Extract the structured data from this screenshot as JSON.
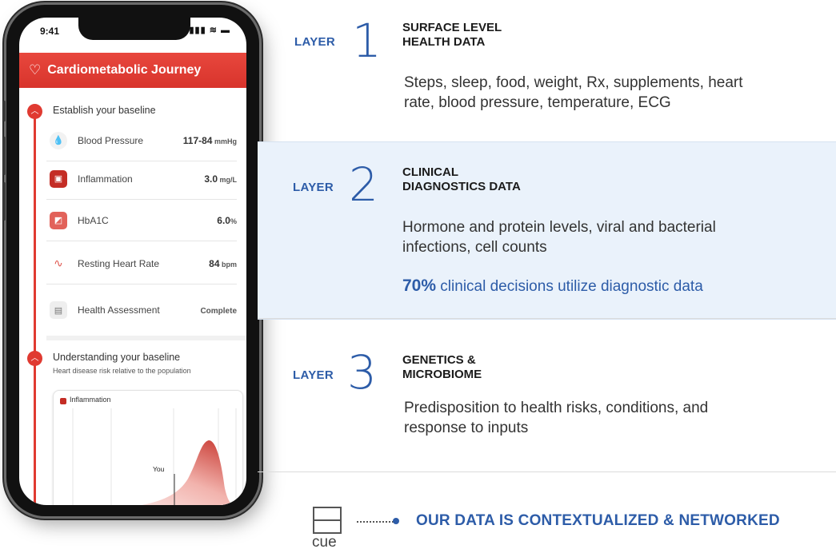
{
  "phone": {
    "status_time": "9:41",
    "status_icons": "▮▮▮ ≋ ▬",
    "app_title": "Cardiometabolic Journey",
    "section1": {
      "title": "Establish your baseline",
      "metrics": [
        {
          "label": "Blood Pressure",
          "value": "117-84",
          "unit": " mmHg",
          "icon": "blood-drop-icon"
        },
        {
          "label": "Inflammation",
          "value": "3.0",
          "unit": " mg/L",
          "icon": "inflammation-icon"
        },
        {
          "label": "HbA1C",
          "value": "6.0",
          "unit": "%",
          "icon": "hba1c-icon"
        },
        {
          "label": "Resting Heart Rate",
          "value": "84",
          "unit": " bpm",
          "icon": "heartbeat-icon"
        },
        {
          "label": "Health Assessment",
          "value": "",
          "unit": "Complete",
          "icon": "document-icon"
        }
      ]
    },
    "section2": {
      "title": "Understanding your baseline",
      "subtitle": "Heart disease risk relative to the population"
    },
    "chart": {
      "legend": "Inflammation",
      "marker_label": "You",
      "color": "#c42d25"
    }
  },
  "layers": [
    {
      "word": "LAYER",
      "number": "1",
      "heading_line1": "SURFACE LEVEL",
      "heading_line2": "HEALTH DATA",
      "desc_line1": "Steps, sleep, food, weight, Rx, supplements, heart",
      "desc_line2": "rate, blood pressure, temperature, ECG"
    },
    {
      "word": "LAYER",
      "number": "2",
      "heading_line1": "CLINICAL",
      "heading_line2": "DIAGNOSTICS DATA",
      "desc_line1": "Hormone and protein levels, viral and bacterial",
      "desc_line2": "infections, cell counts",
      "stat_pct": "70%",
      "stat_text": " clinical decisions utilize diagnostic data"
    },
    {
      "word": "LAYER",
      "number": "3",
      "heading_line1": "GENETICS &",
      "heading_line2": "MICROBIOME",
      "desc_line1": "Predisposition to health risks, conditions, and",
      "desc_line2": "response to inputs"
    }
  ],
  "footer": {
    "logo_text": "cue",
    "tagline": "OUR DATA IS CONTEXTUALIZED & NETWORKED"
  },
  "colors": {
    "brand_red": "#e03a31",
    "brand_blue": "#2d5ca8",
    "band": "#eaf2fb"
  }
}
